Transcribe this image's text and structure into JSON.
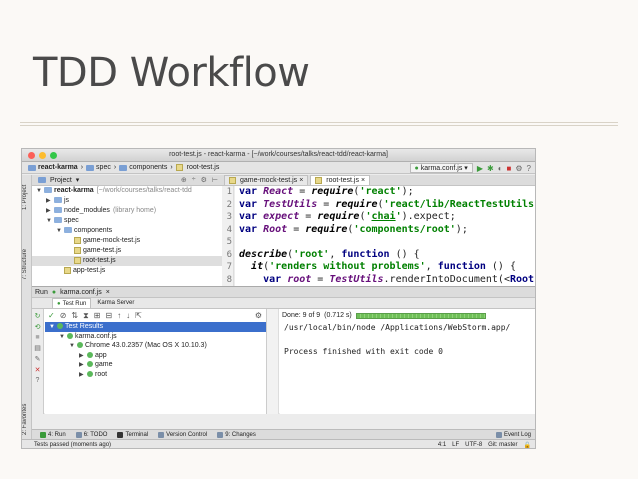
{
  "slide": {
    "title": "TDD Workflow"
  },
  "window": {
    "title": "root-test.js - react-karma - [~/work/courses/talks/react-tdd/react-karma]"
  },
  "navbar": {
    "crumbs": [
      "react-karma",
      "spec",
      "components",
      "root-test.js"
    ],
    "run_config": "karma.conf.js"
  },
  "project_panel": {
    "header": "Project",
    "tree": [
      {
        "label": "react-karma",
        "extra": "[~/work/courses/talks/react-tdd",
        "arrow": "▼",
        "type": "folder",
        "indent": 0
      },
      {
        "label": "js",
        "extra": "",
        "arrow": "▶",
        "type": "folder",
        "indent": 1
      },
      {
        "label": "node_modules",
        "extra": "(library home)",
        "arrow": "▶",
        "type": "folder",
        "indent": 1
      },
      {
        "label": "spec",
        "extra": "",
        "arrow": "▼",
        "type": "folder",
        "indent": 1
      },
      {
        "label": "components",
        "extra": "",
        "arrow": "▼",
        "type": "folder",
        "indent": 2
      },
      {
        "label": "game-mock-test.js",
        "extra": "",
        "arrow": "",
        "type": "js",
        "indent": 3
      },
      {
        "label": "game-test.js",
        "extra": "",
        "arrow": "",
        "type": "js",
        "indent": 3
      },
      {
        "label": "root-test.js",
        "extra": "",
        "arrow": "",
        "type": "js",
        "indent": 3,
        "selected": true
      },
      {
        "label": "app-test.js",
        "extra": "",
        "arrow": "",
        "type": "js",
        "indent": 2
      }
    ]
  },
  "side_tabs": {
    "project": "1: Project",
    "structure": "7: Structure",
    "favorites": "2: Favorites"
  },
  "editor": {
    "tabs": [
      {
        "label": "game-mock-test.js",
        "active": false
      },
      {
        "label": "root-test.js",
        "active": true
      }
    ],
    "line_numbers": [
      "1",
      "2",
      "3",
      "4",
      "5",
      "6",
      "7",
      "8"
    ]
  },
  "run_panel": {
    "header": "Run",
    "config": "karma.conf.js",
    "subtabs": [
      "Test Run",
      "Karma Server"
    ],
    "status": "Done: 9 of 9",
    "time": "(0.712 s)",
    "progress": 1.0,
    "results": [
      {
        "label": "Test Results",
        "indent": 0,
        "arrow": "▼",
        "selected": true
      },
      {
        "label": "karma.conf.js",
        "indent": 1,
        "arrow": "▼"
      },
      {
        "label": "Chrome 43.0.2357 (Mac OS X 10.10.3)",
        "indent": 2,
        "arrow": "▼"
      },
      {
        "label": "app",
        "indent": 3,
        "arrow": "▶"
      },
      {
        "label": "game",
        "indent": 3,
        "arrow": "▶"
      },
      {
        "label": "root",
        "indent": 3,
        "arrow": "▶"
      }
    ],
    "console": [
      "/usr/local/bin/node /Applications/WebStorm.app/",
      "",
      "Process finished with exit code 0"
    ]
  },
  "bottom_tabs": [
    "4: Run",
    "6: TODO",
    "Terminal",
    "Version Control",
    "9: Changes",
    "Event Log"
  ],
  "statusbar": {
    "message": "Tests passed (moments ago)",
    "position": "4:1",
    "line_sep": "LF",
    "encoding": "UTF-8",
    "branch": "Git: master"
  },
  "colors": {
    "traffic_red": "#fc5f57",
    "traffic_yellow": "#fdbc2e",
    "traffic_green": "#33c748",
    "pass_green": "#5bb85b",
    "selection": "#3b6fcc"
  }
}
